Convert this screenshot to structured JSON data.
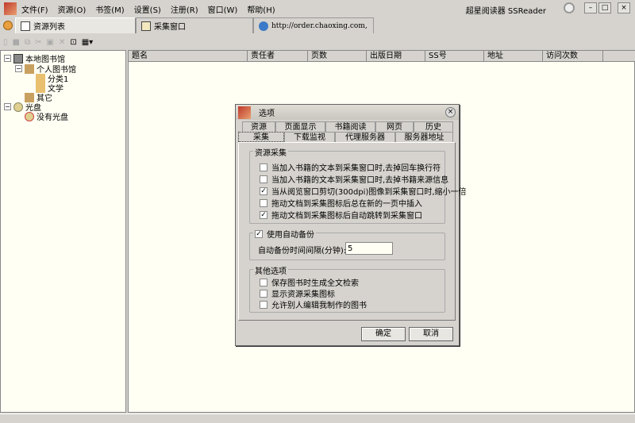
{
  "app": {
    "title": "超星阅读器 SSReader"
  },
  "menu": [
    "文件(F)",
    "资源(O)",
    "书签(M)",
    "设置(S)",
    "注册(R)",
    "窗口(W)",
    "帮助(H)"
  ],
  "tabs": [
    {
      "label": "资源列表"
    },
    {
      "label": "采集窗口"
    },
    {
      "label": "http://order.chaoxing.com,"
    }
  ],
  "tree": {
    "root1": "本地图书馆",
    "personal": "个人图书馆",
    "cat1": "分类1",
    "cat2": "文学",
    "other": "其它",
    "root2": "光盘",
    "nodisc": "没有光盘"
  },
  "columns": [
    "题名",
    "责任者",
    "页数",
    "出版日期",
    "SS号",
    "地址",
    "访问次数"
  ],
  "dialog": {
    "title": "选项",
    "tabs_row1": [
      "资源",
      "页面显示",
      "书籍阅读",
      "网页",
      "历史"
    ],
    "tabs_row2": [
      "采集",
      "下载监视",
      "代理服务器",
      "服务器地址"
    ],
    "group1": {
      "label": "资源采集",
      "options": [
        {
          "label": "当加入书籍的文本到采集窗口时,去掉回车换行符",
          "checked": false
        },
        {
          "label": "当加入书籍的文本到采集窗口时,去掉书籍来源信息",
          "checked": false
        },
        {
          "label": "当从阅览窗口剪切(300dpi)图像到采集窗口时,缩小一倍",
          "checked": true
        },
        {
          "label": "拖动文档到采集图标后总在新的一页中插入",
          "checked": false
        },
        {
          "label": "拖动文档到采集图标后自动跳转到采集窗口",
          "checked": true
        }
      ]
    },
    "group2": {
      "label": "使用自动备份",
      "checked": true,
      "interval_label": "自动备份时间间隔(分钟):",
      "interval_value": "5"
    },
    "group3": {
      "label": "其他选项",
      "options": [
        {
          "label": "保存图书时生成全文检索",
          "checked": false
        },
        {
          "label": "显示资源采集图标",
          "checked": false
        },
        {
          "label": "允许别人编辑我制作的图书",
          "checked": false
        }
      ]
    },
    "ok": "确定",
    "cancel": "取消"
  }
}
